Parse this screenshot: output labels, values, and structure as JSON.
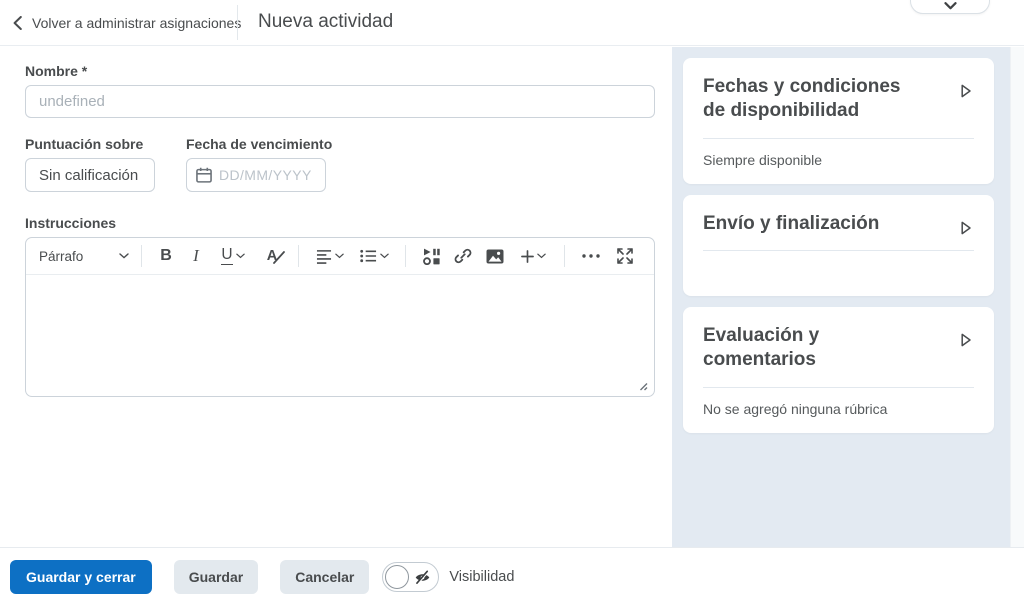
{
  "header": {
    "back_label": "Volver a administrar asignaciones",
    "title": "Nueva actividad"
  },
  "form": {
    "name_label": "Nombre",
    "name_required_marker": "*",
    "name_placeholder": "undefined",
    "score_label": "Puntuación sobre",
    "score_value": "Sin calificación",
    "due_date_label": "Fecha de vencimiento",
    "due_date_placeholder": "DD/MM/YYYY",
    "instructions_label": "Instrucciones"
  },
  "editor_toolbar": {
    "paragraph": "Párrafo",
    "bold": "B",
    "italic": "I",
    "underline": "U",
    "font_color": "A"
  },
  "sidebar": {
    "panels": [
      {
        "title": "Fechas y condiciones de disponibilidad",
        "summary": "Siempre disponible"
      },
      {
        "title": "Envío y finalización",
        "summary": ""
      },
      {
        "title": "Evaluación y comentarios",
        "summary": "No se agregó ninguna rúbrica"
      }
    ]
  },
  "footer": {
    "save_and_close": "Guardar y cerrar",
    "save": "Guardar",
    "cancel": "Cancelar",
    "visibility": "Visibilidad",
    "visibility_state": "off"
  },
  "icons": {
    "back": "chevron-left",
    "collapse_panel": "chevron-down",
    "due_date": "calendar",
    "panel_expand": "chevron-right-triangle",
    "visibility": "eye-off",
    "editor_resize": "diagonal-grip",
    "editor": [
      "paragraph-dropdown",
      "bold",
      "italic",
      "underline",
      "font-color",
      "align-left",
      "bullet-list",
      "insert-stuff",
      "link",
      "image",
      "plus",
      "ellipsis",
      "fullscreen"
    ]
  },
  "colors": {
    "primary_button": "#0d70c4",
    "text": "#494c4e",
    "sidebar_bg": "#e3eaf2",
    "input_border": "#ccd3da"
  }
}
